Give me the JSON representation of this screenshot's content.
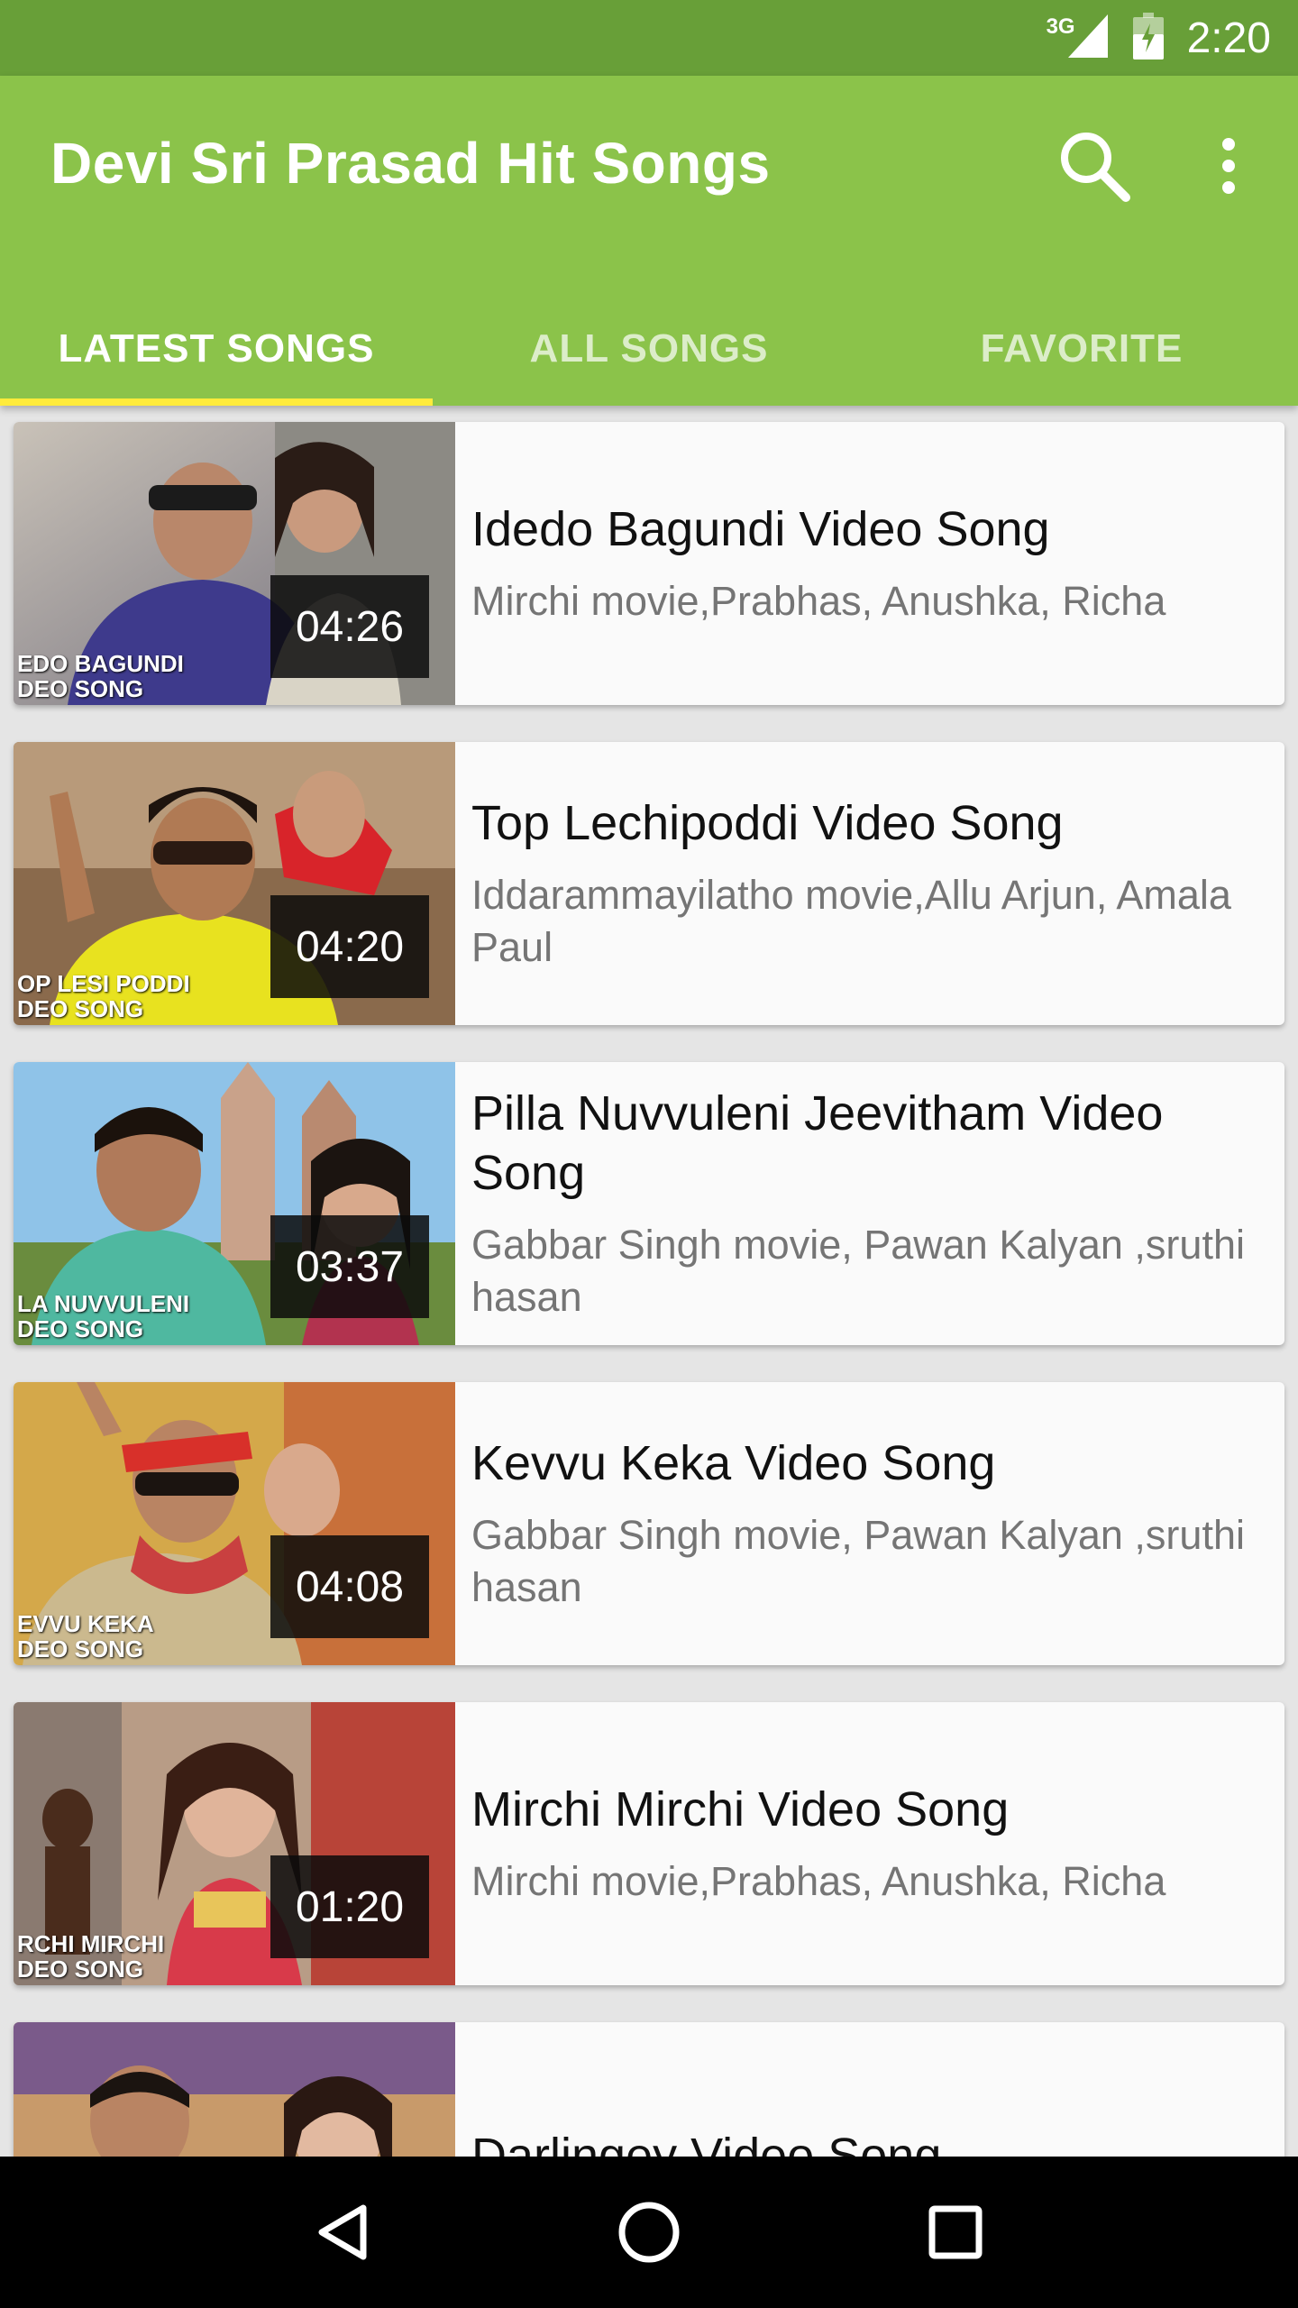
{
  "status": {
    "network": "3G",
    "time": "2:20"
  },
  "app": {
    "title": "Devi Sri Prasad Hit Songs"
  },
  "tabs": [
    {
      "label": "LATEST SONGS",
      "selected": true
    },
    {
      "label": "ALL SONGS",
      "selected": false
    },
    {
      "label": "FAVORITE",
      "selected": false
    }
  ],
  "songs": [
    {
      "title": "Idedo Bagundi Video Song",
      "subtitle": "Mirchi movie,Prabhas, Anushka, Richa",
      "duration": "04:26",
      "caption": "EDO BAGUNDI\nDEO SONG"
    },
    {
      "title": "Top Lechipoddi Video Song",
      "subtitle": "Iddarammayilatho movie,Allu Arjun, Amala Paul",
      "duration": "04:20",
      "caption": "OP LESI PODDI\nDEO SONG"
    },
    {
      "title": "Pilla Nuvvuleni Jeevitham Video Song",
      "subtitle": "Gabbar Singh movie, Pawan Kalyan ,sruthi hasan",
      "duration": "03:37",
      "caption": "LA NUVVULENI\nDEO SONG"
    },
    {
      "title": "Kevvu Keka Video Song",
      "subtitle": "Gabbar Singh movie, Pawan Kalyan ,sruthi hasan",
      "duration": "04:08",
      "caption": "EVVU KEKA\nDEO SONG"
    },
    {
      "title": "Mirchi Mirchi Video Song",
      "subtitle": "Mirchi movie,Prabhas, Anushka, Richa",
      "duration": "01:20",
      "caption": "RCHI MIRCHI\nDEO SONG"
    },
    {
      "title": "Darlingey Video Song",
      "subtitle": "",
      "duration": "",
      "caption": ""
    }
  ],
  "colors": {
    "status_bar": "#689f38",
    "app_bar": "#8bc34a",
    "tab_indicator": "#ffeb3b"
  },
  "icons": {
    "search": "search-icon",
    "more": "more-vert-icon",
    "back": "back-icon",
    "home": "home-icon",
    "recents": "recents-icon"
  }
}
